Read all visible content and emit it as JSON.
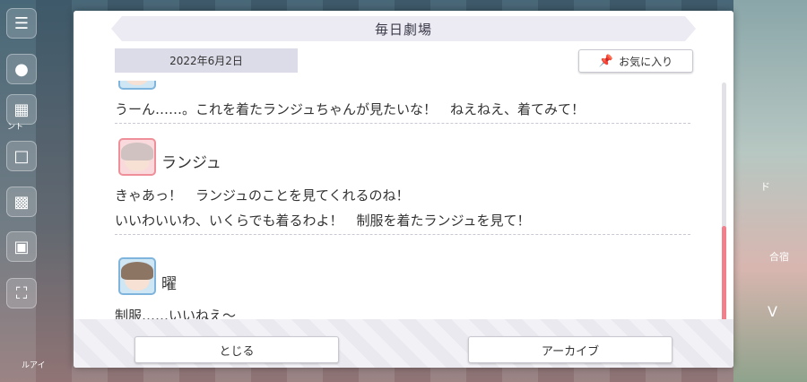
{
  "dialog": {
    "title": "毎日劇場",
    "date": "2022年6月2日",
    "favorite_label": "お気に入り",
    "close_label": "とじる",
    "archive_label": "アーカイブ"
  },
  "entries": [
    {
      "line": "うーん……。これを着たランジュちゃんが見たいな！　ねえねえ、着てみて！"
    },
    {
      "speaker": "ランジュ",
      "lines": [
        "きゃあっ！　ランジュのことを見てくれるのね！",
        "いいわいいわ、いくらでも着るわよ！　制服を着たランジュを見て！"
      ]
    },
    {
      "speaker": "曜",
      "lines": [
        "制服……いいねえ～"
      ]
    }
  ],
  "background": {
    "tag_left": "ント",
    "tag_bottom": "ルアイ",
    "right_label": "合宿",
    "right_letter": "V",
    "right_bottom": "ド"
  },
  "colors": {
    "accent": "#f27f8c",
    "title_bg": "#ecebf3",
    "date_bg": "#dcdbe8"
  },
  "icons": [
    "menu-icon",
    "chat-icon",
    "gift-icon",
    "present-icon",
    "screen-icon",
    "photo-icon",
    "fullscreen-icon",
    "pin-icon"
  ]
}
